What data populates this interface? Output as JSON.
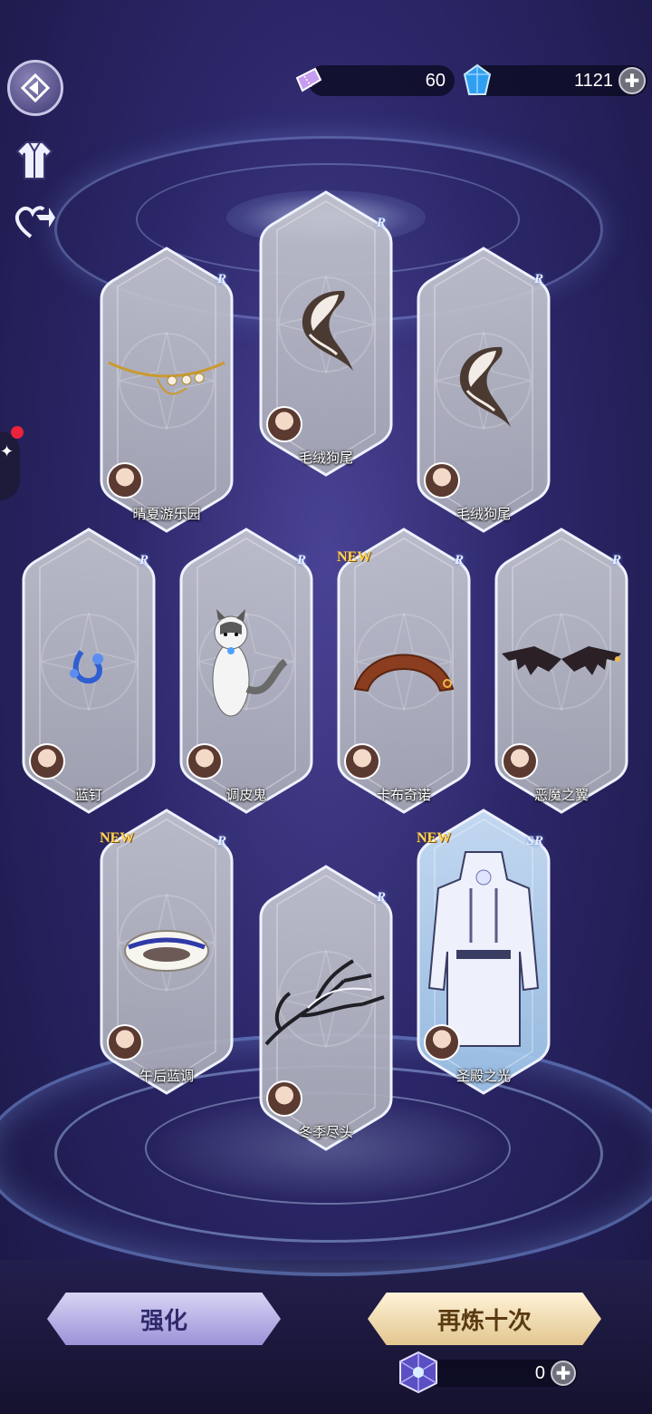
{
  "currencies": {
    "ticket": {
      "value": "60",
      "icon": "ticket-icon"
    },
    "gem": {
      "value": "1121",
      "icon": "blue-gem-icon"
    }
  },
  "sidebar": {
    "back": "back-diamond-icon",
    "outfit": "outfit-icon",
    "share": "share-heart-icon"
  },
  "cards": [
    {
      "name": "晴夏游乐园",
      "rarity": "R",
      "new": "",
      "item": "gold-necklace"
    },
    {
      "name": "毛绒狗尾",
      "rarity": "R",
      "new": "",
      "item": "fluffy-tail"
    },
    {
      "name": "毛绒狗尾",
      "rarity": "R",
      "new": "",
      "item": "fluffy-tail"
    },
    {
      "name": "蓝钉",
      "rarity": "R",
      "new": "",
      "item": "blue-earring"
    },
    {
      "name": "调皮鬼",
      "rarity": "R",
      "new": "",
      "item": "cat"
    },
    {
      "name": "卡布奇诺",
      "rarity": "R",
      "new": "NEW",
      "item": "brown-headband"
    },
    {
      "name": "恶魔之翼",
      "rarity": "R",
      "new": "",
      "item": "bat-wings"
    },
    {
      "name": "午后蓝调",
      "rarity": "R",
      "new": "NEW",
      "item": "white-hat"
    },
    {
      "name": "冬季尽头",
      "rarity": "R",
      "new": "",
      "item": "dark-branches"
    },
    {
      "name": "圣殿之光",
      "rarity": "SR",
      "new": "NEW",
      "item": "white-coat"
    }
  ],
  "buttons": {
    "enhance": "强化",
    "refine_ten": "再炼十次"
  },
  "refine_cost": {
    "value": "0"
  }
}
